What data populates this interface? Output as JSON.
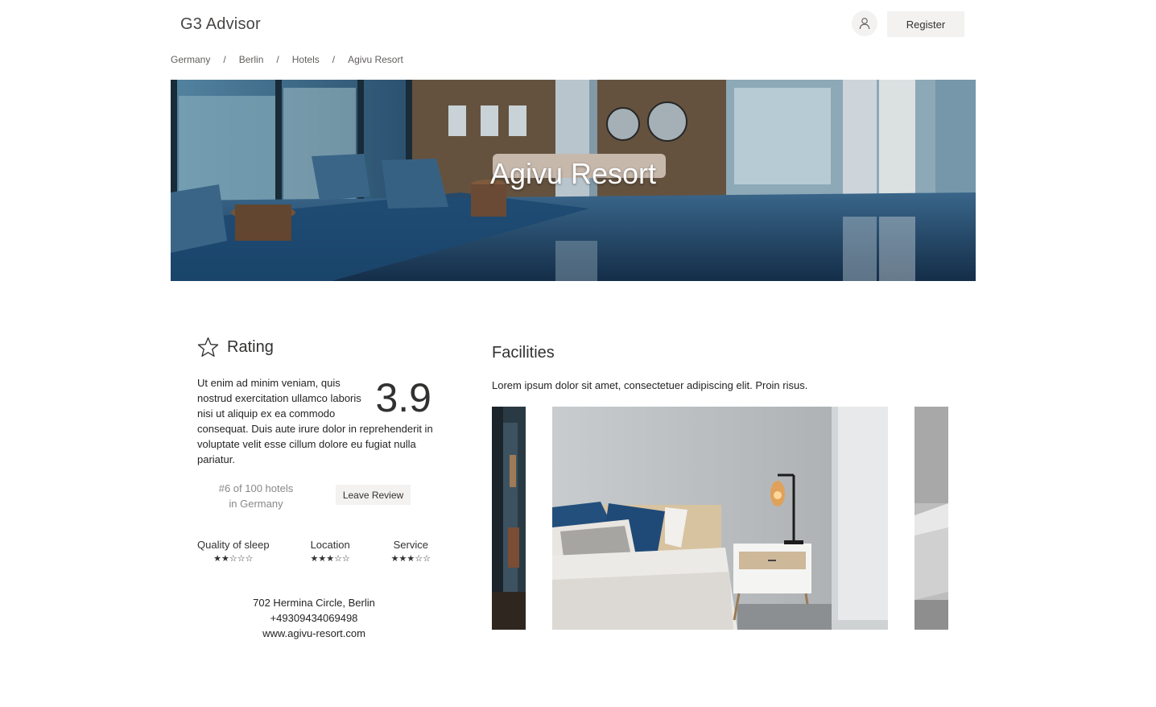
{
  "header": {
    "brand": "G3 Advisor",
    "user_icon": "user-icon",
    "register_label": "Register"
  },
  "breadcrumb": {
    "items": [
      "Germany",
      "Berlin",
      "Hotels",
      "Agivu Resort"
    ],
    "separator": "/"
  },
  "hero": {
    "title": "Agivu Resort"
  },
  "rating": {
    "icon": "star-outline-icon",
    "heading": "Rating",
    "description": "Ut enim ad minim veniam, quis nostrud exercitation ullamco laboris nisi ut aliquip ex ea commodo consequat. Duis aute irure dolor in reprehenderit in voluptate velit esse cillum dolore eu fugiat nulla pariatur.",
    "score": "3.9",
    "rank_line1": "#6 of 100 hotels",
    "rank_line2": "in Germany",
    "leave_review_label": "Leave Review",
    "sub_ratings": [
      {
        "label": "Quality of sleep",
        "stars": 2,
        "max": 5,
        "stars_text": "★★☆☆☆"
      },
      {
        "label": "Location",
        "stars": 3,
        "max": 5,
        "stars_text": "★★★☆☆"
      },
      {
        "label": "Service",
        "stars": 3,
        "max": 5,
        "stars_text": "★★★☆☆"
      }
    ]
  },
  "contact": {
    "address": "702 Hermina Circle, Berlin",
    "phone": "+49309434069498",
    "website": "www.agivu-resort.com"
  },
  "facilities": {
    "heading": "Facilities",
    "description": "Lorem ipsum dolor sit amet, consectetuer adipiscing elit. Proin risus.",
    "slides": [
      "lounge-photo",
      "bedroom-photo",
      "bathroom-photo"
    ]
  },
  "colors": {
    "button_bg": "#f3f2f1",
    "text": "#252423",
    "muted": "#8a8886",
    "hero_blue": "#1f4f7a"
  }
}
